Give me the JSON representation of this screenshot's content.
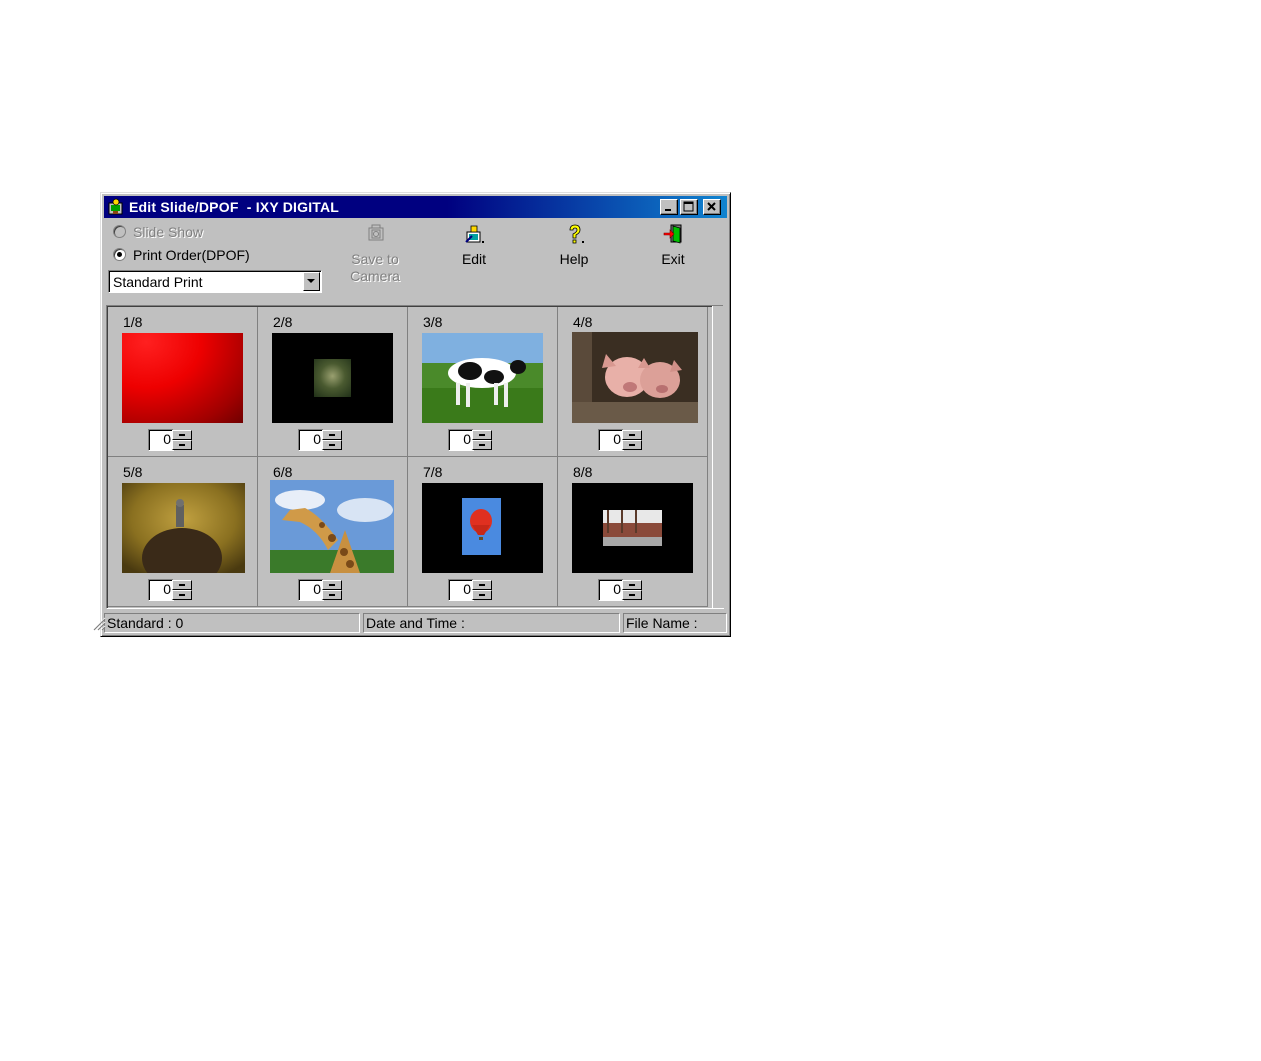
{
  "window": {
    "title": "Edit Slide/DPOF  - IXY DIGITAL"
  },
  "mode": {
    "slide_show": "Slide Show",
    "print_order": "Print Order(DPOF)",
    "selected": "Print Order(DPOF)"
  },
  "print_type": {
    "value": "Standard Print"
  },
  "toolbar": {
    "save_to_camera": "Save to\nCamera",
    "edit": "Edit",
    "help": "Help",
    "exit": "Exit"
  },
  "images": [
    {
      "label": "1/8",
      "count": "0",
      "thumb": "red-gradient"
    },
    {
      "label": "2/8",
      "count": "0",
      "thumb": "small-photo-on-black"
    },
    {
      "label": "3/8",
      "count": "0",
      "thumb": "cow"
    },
    {
      "label": "4/8",
      "count": "0",
      "thumb": "pigs"
    },
    {
      "label": "5/8",
      "count": "0",
      "thumb": "bird-on-rock"
    },
    {
      "label": "6/8",
      "count": "0",
      "thumb": "giraffe"
    },
    {
      "label": "7/8",
      "count": "0",
      "thumb": "hot-air-balloon"
    },
    {
      "label": "8/8",
      "count": "0",
      "thumb": "ship-on-black"
    }
  ],
  "status": {
    "standard": "Standard : 0",
    "date_time": "Date and Time :",
    "file_name": "File Name :"
  },
  "colors": {
    "titlebar_start": "#000080",
    "titlebar_end": "#1084d0",
    "face": "#c0c0c0"
  }
}
